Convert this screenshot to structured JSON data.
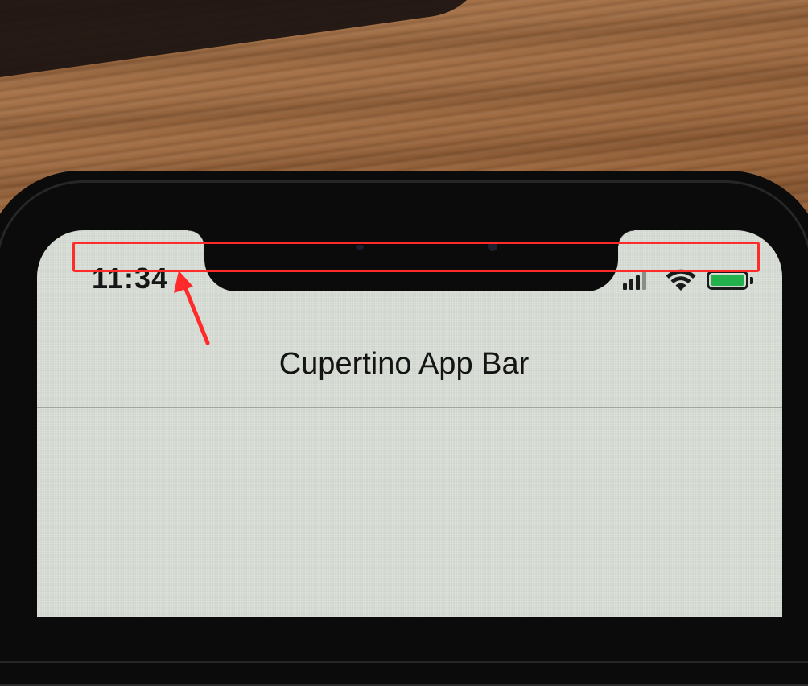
{
  "status_bar": {
    "time": "11:34",
    "signal_icon": "cellular-signal-icon",
    "wifi_icon": "wifi-icon",
    "battery_icon": "battery-icon",
    "battery_color": "#22b14c"
  },
  "app_bar": {
    "title": "Cupertino App Bar"
  },
  "annotation": {
    "highlight_color": "#ff2b2b",
    "arrow_icon": "arrow-icon"
  }
}
